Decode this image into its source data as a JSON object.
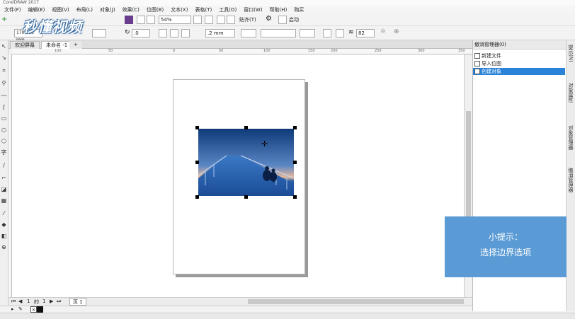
{
  "window": {
    "title": "CorelDRAW 2017",
    "controls": [
      "—",
      "□",
      "×"
    ]
  },
  "menu": [
    "文件(F)",
    "编辑(E)",
    "视图(V)",
    "布局(L)",
    "对象(J)",
    "效果(C)",
    "位图(B)",
    "文本(X)",
    "表格(T)",
    "工具(O)",
    "窗口(W)",
    "帮助(H)",
    "购买"
  ],
  "toolbar1": {
    "zoom": "54%",
    "snap_label": "贴齐(T)",
    "launch_label": "启动"
  },
  "toolbar2": {
    "size_value": "170,288 mm",
    "rotation": ".0",
    "outline_width": ".2 mm",
    "opacity": "82"
  },
  "logo": "秒懂视频",
  "doc_tabs": {
    "welcome": "欢迎屏幕",
    "document": "未命名 -1",
    "add": "+"
  },
  "ruler_ticks": [
    "100",
    "50",
    "0",
    "50",
    "100",
    "150",
    "200",
    "250",
    "300",
    "350"
  ],
  "page_nav": {
    "current": "1",
    "of_label": "的",
    "total": "1",
    "page_tab": "页 1"
  },
  "undo_panel": {
    "title": "撤消管理器(0)",
    "items": [
      {
        "label": "新建文件",
        "selected": false
      },
      {
        "label": "导入位图",
        "selected": false
      },
      {
        "label": "创建对象",
        "selected": true
      }
    ]
  },
  "right_tabs": [
    "提示(N)",
    "对象属性",
    "对象管理器",
    "撤消管理器"
  ],
  "tip": {
    "title": "小提示：",
    "text": "选择边界选项"
  },
  "colors": {
    "accent": "#2a83d8",
    "tip_bg": "#5b9bd5"
  }
}
